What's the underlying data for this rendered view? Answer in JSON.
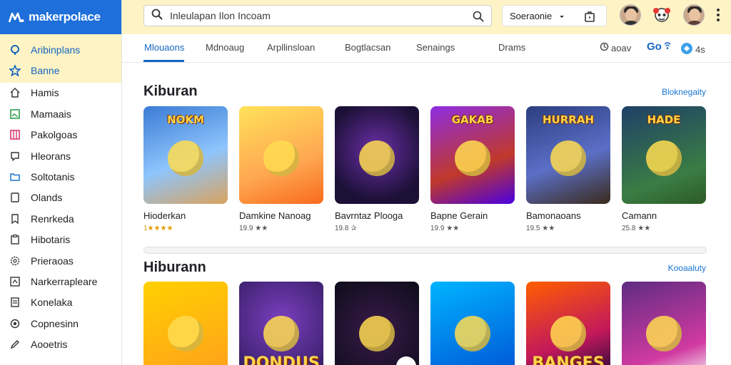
{
  "brand": {
    "name": "makerpolace",
    "color": "#1e6fd9"
  },
  "sidebar": {
    "items": [
      {
        "label": "Aribinplans",
        "icon": "location-pin-icon"
      },
      {
        "label": "Banne",
        "icon": "star-icon"
      },
      {
        "label": "Hamis",
        "icon": "home-icon"
      },
      {
        "label": "Mamaais",
        "icon": "image-icon"
      },
      {
        "label": "Pakolgoas",
        "icon": "library-icon"
      },
      {
        "label": "Hleorans",
        "icon": "chat-bubble-icon"
      },
      {
        "label": "Soltotanis",
        "icon": "folder-icon"
      },
      {
        "label": "Olands",
        "icon": "card-icon"
      },
      {
        "label": "Renrkeda",
        "icon": "bookmark-icon"
      },
      {
        "label": "Hibotaris",
        "icon": "clipboard-icon"
      },
      {
        "label": "Prieraoas",
        "icon": "gear-icon"
      },
      {
        "label": "Narkerrapleare",
        "icon": "store-icon"
      },
      {
        "label": "Konelaka",
        "icon": "document-icon"
      },
      {
        "label": "Copnesinn",
        "icon": "settings-icon"
      },
      {
        "label": "Aooetris",
        "icon": "pencil-icon"
      }
    ]
  },
  "topbar": {
    "search_placeholder": "Inleulapan Ilon Incoam",
    "select_value": "Soeraonie"
  },
  "tabs": [
    {
      "label": "Mlouaons"
    },
    {
      "label": "Mdnoaug"
    },
    {
      "label": "Arpllinsloan"
    },
    {
      "label": "Bogtlacsan"
    },
    {
      "label": "Senaings"
    },
    {
      "label": "Drams"
    }
  ],
  "tab_extras": {
    "item1": "aoav",
    "item2": "Go",
    "item3": "4s"
  },
  "sections": [
    {
      "title": "Kiburan",
      "link": "Bloknegaity",
      "cards": [
        {
          "name": "Hioderkan",
          "meta": "1★★★★",
          "art": "NOKM",
          "bg": "linear-gradient(160deg,#3a7bd5,#8ec5fc 55%,#d9a35e)"
        },
        {
          "name": "Damkine Nanoag",
          "meta": "19.9 ★★",
          "art": "",
          "bg": "linear-gradient(160deg,#ffe259,#ffa751 60%,#f76b1c)"
        },
        {
          "name": "Bavrntaz Plooga",
          "meta": "19.8 ✰",
          "art": "",
          "bg": "radial-gradient(circle at 50% 45%,#6b2fa8,#1b1035 75%)"
        },
        {
          "name": "Bapne Gerain",
          "meta": "19.9 ★★",
          "art": "GAKAB",
          "bg": "linear-gradient(160deg,#8e2de2,#c0392b 60%,#4a00e0)"
        },
        {
          "name": "Bamonaoans",
          "meta": "19.5 ★★",
          "art": "HURRAH",
          "bg": "linear-gradient(160deg,#2c3e80,#5b6fc7 55%,#3a2a1a)"
        },
        {
          "name": "Camann",
          "meta": "25.8 ★★",
          "art": "HADE",
          "bg": "linear-gradient(160deg,#1f4068,#3a7d44 70%,#2d5a27)"
        }
      ]
    },
    {
      "title": "Hiburann",
      "link": "Kooaaluty",
      "cards": [
        {
          "name": "",
          "meta": "",
          "art": "",
          "bg": "linear-gradient(160deg,#ffd000,#ff9f1c)"
        },
        {
          "name": "",
          "meta": "",
          "art": "DONDUS",
          "bg": "radial-gradient(circle at 50% 40%,#7b3fbf,#2d1a5a)"
        },
        {
          "name": "",
          "meta": "",
          "art": "",
          "bg": "radial-gradient(circle at 50% 50%,#3a1a4a,#0d0d1a)"
        },
        {
          "name": "",
          "meta": "",
          "art": "",
          "bg": "linear-gradient(160deg,#00b4ff,#0052d4)"
        },
        {
          "name": "",
          "meta": "",
          "art": "BANGES",
          "bg": "linear-gradient(160deg,#ff5e00,#c2185b 60%,#1a0a3a)"
        },
        {
          "name": "",
          "meta": "",
          "art": "",
          "bg": "linear-gradient(160deg,#5f2c82,#d13aa1 70%,#f7f7f7)"
        }
      ]
    }
  ]
}
